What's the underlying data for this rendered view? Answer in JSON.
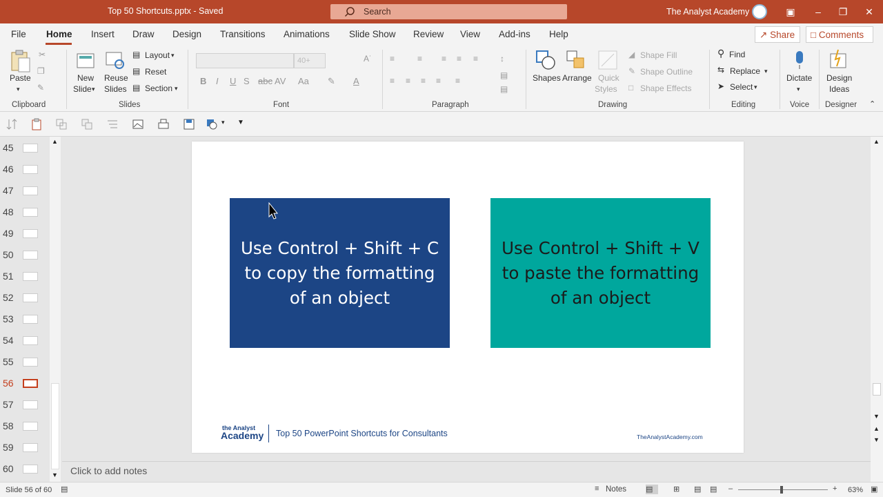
{
  "window": {
    "doc_title": "Top 50 Shortcuts.pptx  -  Saved",
    "search_placeholder": "Search",
    "user_name": "The Analyst Academy"
  },
  "menu": {
    "tabs": [
      "File",
      "Home",
      "Insert",
      "Draw",
      "Design",
      "Transitions",
      "Animations",
      "Slide Show",
      "Review",
      "View",
      "Add-ins",
      "Help"
    ],
    "active_tab": "Home",
    "share_label": "Share",
    "comments_label": "Comments"
  },
  "ribbon": {
    "clipboard": {
      "paste": "Paste",
      "group": "Clipboard"
    },
    "slides": {
      "new_slide_1": "New",
      "new_slide_2": "Slide",
      "reuse_1": "Reuse",
      "reuse_2": "Slides",
      "layout": "Layout",
      "reset": "Reset",
      "section": "Section",
      "group": "Slides"
    },
    "font": {
      "size_value": "40+",
      "group": "Font"
    },
    "paragraph": {
      "group": "Paragraph"
    },
    "drawing": {
      "shapes": "Shapes",
      "arrange": "Arrange",
      "quick_1": "Quick",
      "quick_2": "Styles",
      "shape_fill": "Shape Fill",
      "shape_outline": "Shape Outline",
      "shape_effects": "Shape Effects",
      "group": "Drawing"
    },
    "editing": {
      "find": "Find",
      "replace": "Replace",
      "select": "Select",
      "group": "Editing"
    },
    "voice": {
      "dictate": "Dictate",
      "group": "Voice"
    },
    "designer": {
      "ideas_1": "Design",
      "ideas_2": "Ideas",
      "group": "Designer"
    }
  },
  "slide_panel": {
    "numbers": [
      "45",
      "46",
      "47",
      "48",
      "49",
      "50",
      "51",
      "52",
      "53",
      "54",
      "55",
      "56",
      "57",
      "58",
      "59",
      "60"
    ],
    "current": "56"
  },
  "slide": {
    "left_box_text": "Use Control + Shift + C to copy the formatting of an object",
    "right_box_text": "Use Control + Shift + V to paste the formatting of an object",
    "left_box_color": "#1c4585",
    "right_box_color": "#00a79d",
    "logo_top": "the Analyst",
    "logo_main": "Academy",
    "footer_title": "Top 50 PowerPoint Shortcuts for Consultants",
    "footer_url": "TheAnalystAcademy.com"
  },
  "notes": {
    "placeholder": "Click to add notes"
  },
  "status": {
    "slide_count": "Slide 56 of 60",
    "notes_label": "Notes",
    "zoom_level": "63%"
  },
  "colors": {
    "accent": "#b7472a"
  }
}
